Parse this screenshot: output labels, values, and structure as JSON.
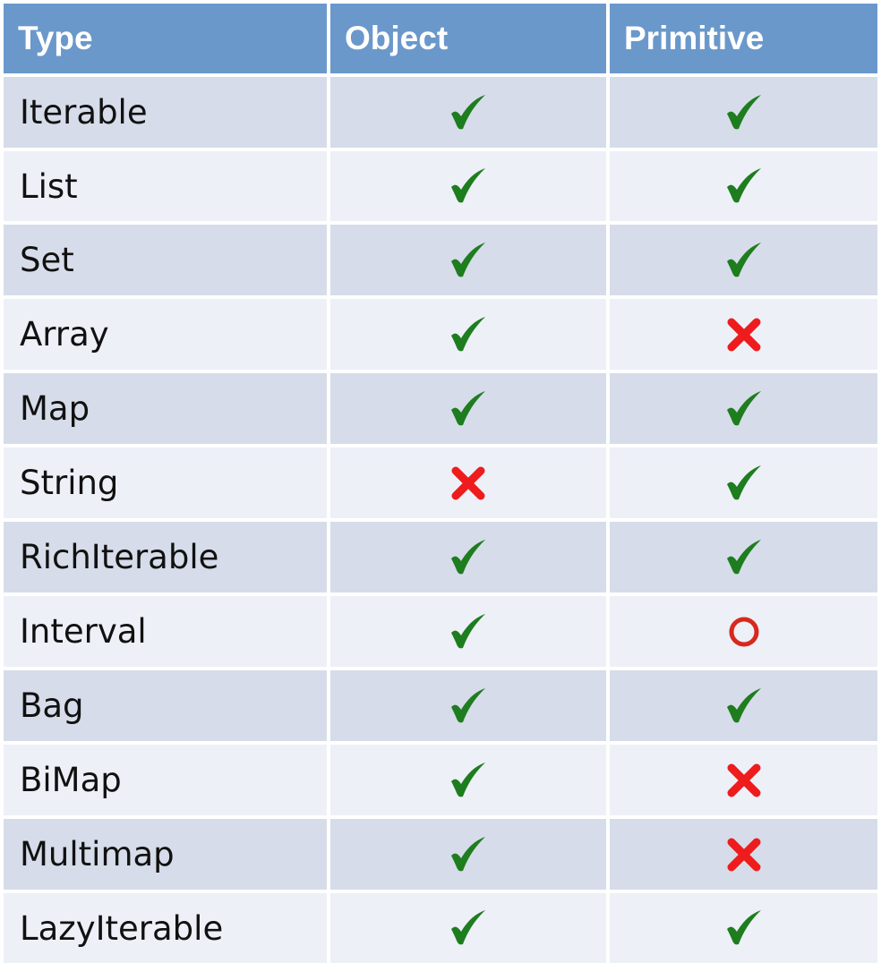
{
  "table": {
    "headers": [
      "Type",
      "Object",
      "Primitive"
    ],
    "rows": [
      {
        "type": "Iterable",
        "object": "check",
        "primitive": "check"
      },
      {
        "type": "List",
        "object": "check",
        "primitive": "check"
      },
      {
        "type": "Set",
        "object": "check",
        "primitive": "check"
      },
      {
        "type": "Array",
        "object": "check",
        "primitive": "cross"
      },
      {
        "type": "Map",
        "object": "check",
        "primitive": "check"
      },
      {
        "type": "String",
        "object": "cross",
        "primitive": "check"
      },
      {
        "type": "RichIterable",
        "object": "check",
        "primitive": "check"
      },
      {
        "type": "Interval",
        "object": "check",
        "primitive": "circle"
      },
      {
        "type": "Bag",
        "object": "check",
        "primitive": "check"
      },
      {
        "type": "BiMap",
        "object": "check",
        "primitive": "cross"
      },
      {
        "type": "Multimap",
        "object": "check",
        "primitive": "cross"
      },
      {
        "type": "LazyIterable",
        "object": "check",
        "primitive": "check"
      }
    ]
  },
  "icons": {
    "check": "check-icon",
    "cross": "cross-icon",
    "circle": "circle-icon"
  },
  "colors": {
    "header_bg": "#6a98cb",
    "row_odd_bg": "#d6dce9",
    "row_even_bg": "#edf0f7",
    "check": "#1e7d1e",
    "cross": "#ee1c1c",
    "circle": "#d8281e"
  }
}
